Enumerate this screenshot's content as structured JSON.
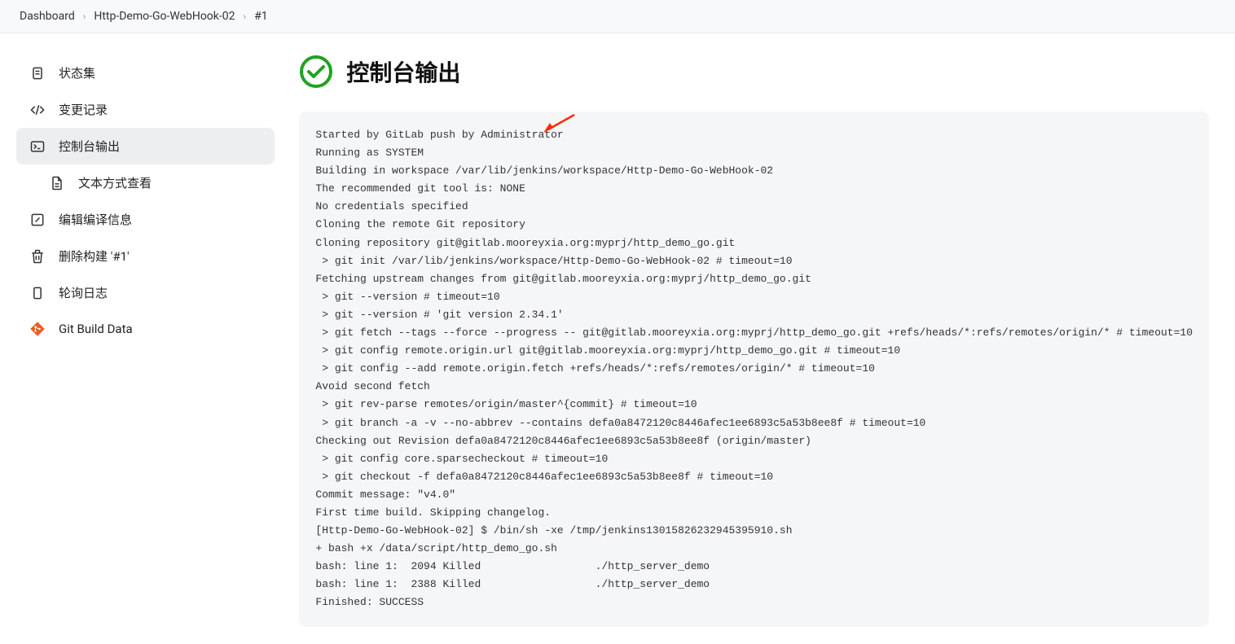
{
  "breadcrumb": {
    "items": [
      "Dashboard",
      "Http-Demo-Go-WebHook-02",
      "#1"
    ]
  },
  "sidebar": {
    "items": [
      {
        "label": "状态集",
        "icon": "clipboard"
      },
      {
        "label": "变更记录",
        "icon": "code"
      },
      {
        "label": "控制台输出",
        "icon": "terminal",
        "active": true
      },
      {
        "label": "文本方式查看",
        "icon": "document",
        "sub": true
      },
      {
        "label": "编辑编译信息",
        "icon": "edit"
      },
      {
        "label": "删除构建 '#1'",
        "icon": "trash"
      },
      {
        "label": "轮询日志",
        "icon": "clipboard-blank"
      },
      {
        "label": "Git Build Data",
        "icon": "git"
      }
    ]
  },
  "header": {
    "title": "控制台输出"
  },
  "console": {
    "lines": [
      "Started by GitLab push by Administrator",
      "Running as SYSTEM",
      "Building in workspace /var/lib/jenkins/workspace/Http-Demo-Go-WebHook-02",
      "The recommended git tool is: NONE",
      "No credentials specified",
      "Cloning the remote Git repository",
      "Cloning repository git@gitlab.mooreyxia.org:myprj/http_demo_go.git",
      " > git init /var/lib/jenkins/workspace/Http-Demo-Go-WebHook-02 # timeout=10",
      "Fetching upstream changes from git@gitlab.mooreyxia.org:myprj/http_demo_go.git",
      " > git --version # timeout=10",
      " > git --version # 'git version 2.34.1'",
      " > git fetch --tags --force --progress -- git@gitlab.mooreyxia.org:myprj/http_demo_go.git +refs/heads/*:refs/remotes/origin/* # timeout=10",
      " > git config remote.origin.url git@gitlab.mooreyxia.org:myprj/http_demo_go.git # timeout=10",
      " > git config --add remote.origin.fetch +refs/heads/*:refs/remotes/origin/* # timeout=10",
      "Avoid second fetch",
      " > git rev-parse remotes/origin/master^{commit} # timeout=10",
      " > git branch -a -v --no-abbrev --contains defa0a8472120c8446afec1ee6893c5a53b8ee8f # timeout=10",
      "Checking out Revision defa0a8472120c8446afec1ee6893c5a53b8ee8f (origin/master)",
      " > git config core.sparsecheckout # timeout=10",
      " > git checkout -f defa0a8472120c8446afec1ee6893c5a53b8ee8f # timeout=10",
      "Commit message: \"v4.0\"",
      "First time build. Skipping changelog.",
      "[Http-Demo-Go-WebHook-02] $ /bin/sh -xe /tmp/jenkins13015826232945395910.sh",
      "+ bash +x /data/script/http_demo_go.sh",
      "bash: line 1:  2094 Killed                  ./http_server_demo",
      "bash: line 1:  2388 Killed                  ./http_server_demo",
      "Finished: SUCCESS"
    ]
  }
}
